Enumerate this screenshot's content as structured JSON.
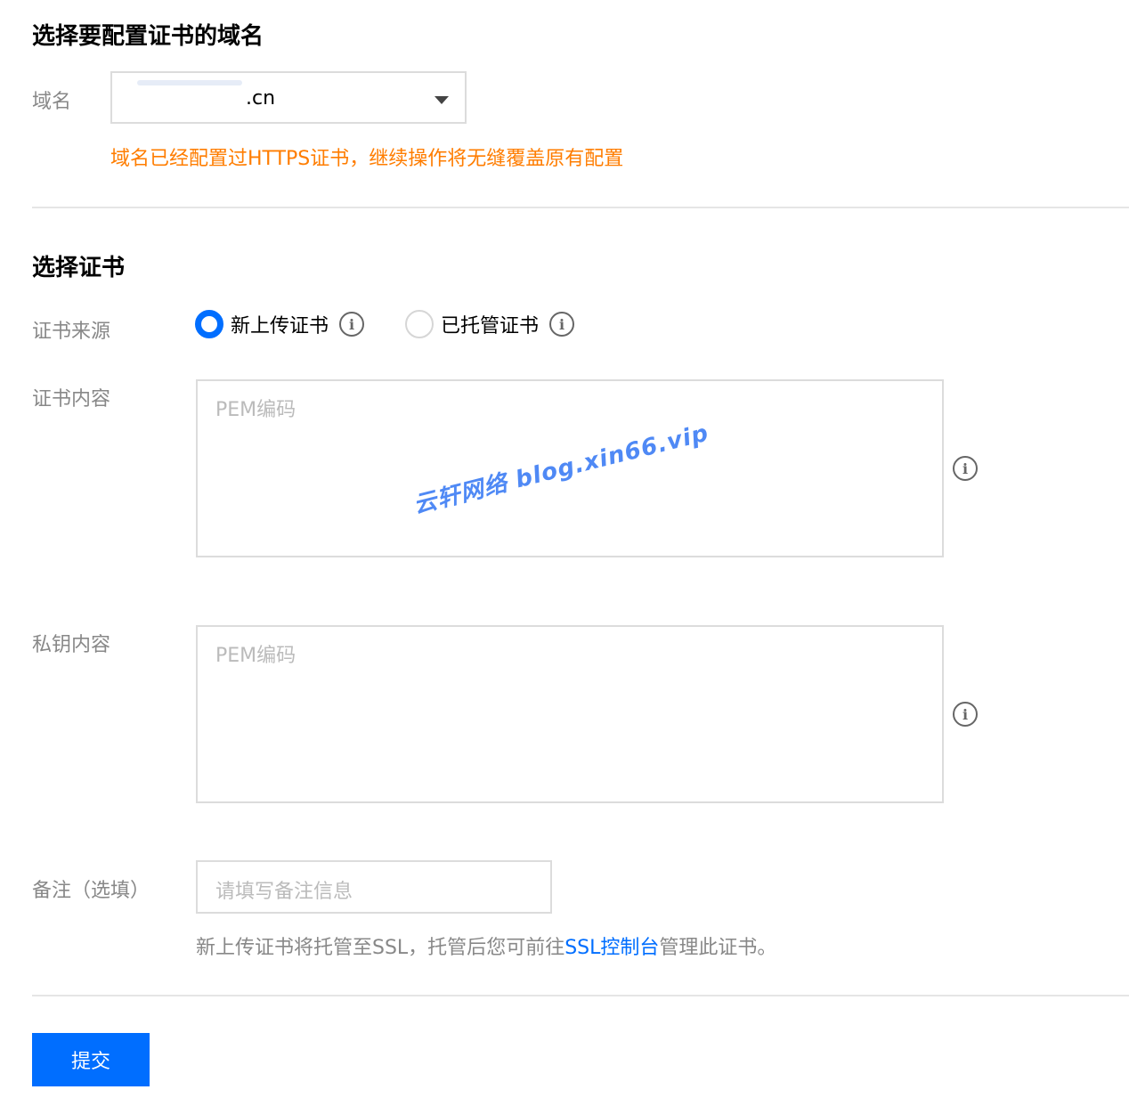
{
  "domain_section": {
    "title": "选择要配置证书的域名",
    "domain_label": "域名",
    "domain_value": ".cn",
    "warning": "域名已经配置过HTTPS证书，继续操作将无缝覆盖原有配置"
  },
  "cert_section": {
    "title": "选择证书",
    "source_label": "证书来源",
    "source_options": [
      {
        "label": "新上传证书",
        "selected": true
      },
      {
        "label": "已托管证书",
        "selected": false
      }
    ],
    "cert_content_label": "证书内容",
    "cert_content_placeholder": "PEM编码",
    "key_content_label": "私钥内容",
    "key_content_placeholder": "PEM编码",
    "remark_label": "备注（选填）",
    "remark_placeholder": "请填写备注信息",
    "help_prefix": "新上传证书将托管至SSL，托管后您可前往",
    "help_link": "SSL控制台",
    "help_suffix": "管理此证书。"
  },
  "submit_label": "提交",
  "watermark": "云轩网络  blog.xin66.vip",
  "icons": {
    "info": "info-icon",
    "dropdown": "chevron-down-icon"
  },
  "colors": {
    "primary": "#006eff",
    "warning": "#ff7d00",
    "label": "#888888"
  }
}
